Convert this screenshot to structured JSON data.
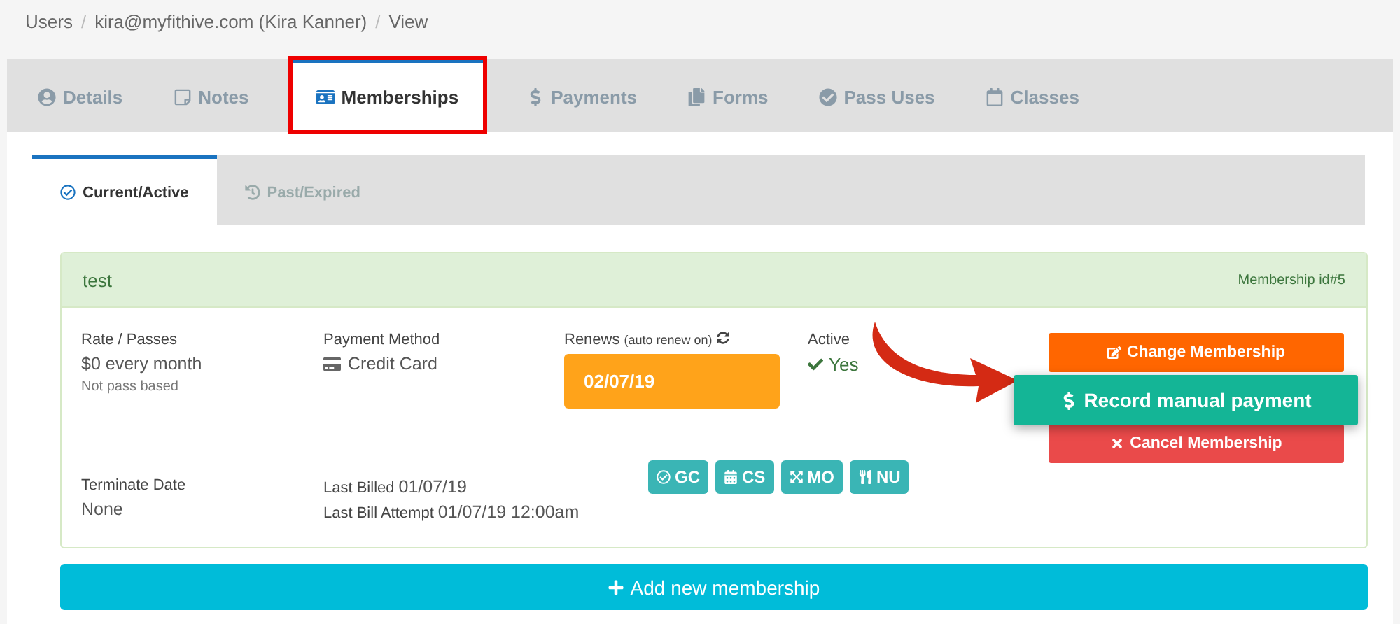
{
  "breadcrumb": [
    "Users",
    "kira@myfithive.com (Kira Kanner)",
    "View"
  ],
  "breadcrumb_separator": "/",
  "tabs": [
    {
      "label": "Details",
      "selected": false,
      "highlighted": false
    },
    {
      "label": "Notes",
      "selected": false,
      "highlighted": false
    },
    {
      "label": "Memberships",
      "selected": true,
      "highlighted": true
    },
    {
      "label": "Payments",
      "selected": false,
      "highlighted": false
    },
    {
      "label": "Forms",
      "selected": false,
      "highlighted": false
    },
    {
      "label": "Pass Uses",
      "selected": false,
      "highlighted": false
    },
    {
      "label": "Classes",
      "selected": false,
      "highlighted": false
    }
  ],
  "subtabs": [
    {
      "label": "Current/Active",
      "selected": true
    },
    {
      "label": "Past/Expired",
      "selected": false
    }
  ],
  "membership": {
    "name": "test",
    "id_label": "Membership id#5",
    "rate": {
      "label": "Rate / Passes",
      "value": "$0 every month",
      "note": "Not pass based"
    },
    "payment_method": {
      "label": "Payment Method",
      "value": "Credit Card"
    },
    "renews": {
      "label": "Renews",
      "note": "(auto renew on)",
      "date": "02/07/19"
    },
    "active": {
      "label": "Active",
      "value": "Yes"
    },
    "terminate": {
      "label": "Terminate Date",
      "value": "None"
    },
    "last_billed": {
      "label": "Last Billed",
      "value": "01/07/19"
    },
    "last_attempt": {
      "label": "Last Bill Attempt",
      "value": "01/07/19 12:00am"
    },
    "badges": [
      "GC",
      "CS",
      "MO",
      "NU"
    ],
    "buttons": [
      {
        "kind": "change",
        "label": "Change Membership"
      },
      {
        "kind": "cancel",
        "label": "Cancel Membership"
      }
    ],
    "callout": {
      "label": "Record manual payment"
    }
  },
  "add_button": "Add new membership"
}
